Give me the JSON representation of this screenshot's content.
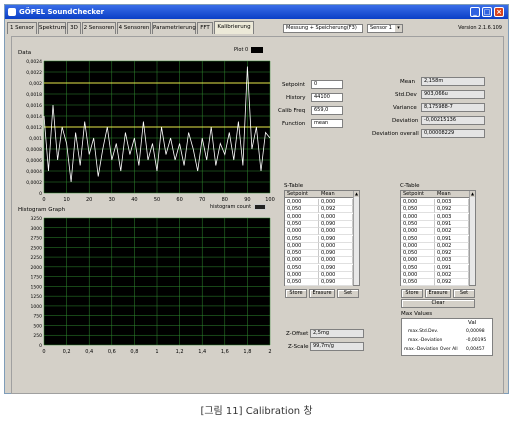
{
  "window": {
    "title": "GÖPEL SoundChecker"
  },
  "tabs": [
    "1 Sensor",
    "Spektrum",
    "3D",
    "2 Sensoren",
    "4 Sensoren",
    "Parametrierung",
    "FFT",
    "Kalibrierung"
  ],
  "toolbar": {
    "mode_select": "Messung + Speicherung(F3)",
    "sensor_select": "Sensor 1",
    "version": "Version 2.1.6.109"
  },
  "data_plot": {
    "title": "Data",
    "legend": "Plot 0",
    "y_ticks": [
      "0,0024",
      "0,0022",
      "0,002",
      "0,0018",
      "0,0016",
      "0,0014",
      "0,0012",
      "0,001",
      "0,0008",
      "0,0006",
      "0,0004",
      "0,0002",
      "0"
    ],
    "x_ticks": [
      "0",
      "10",
      "20",
      "30",
      "40",
      "50",
      "60",
      "70",
      "80",
      "90",
      "100"
    ]
  },
  "histogram": {
    "title": "Histogram Graph",
    "legend": "histogram count",
    "y_ticks": [
      "3250",
      "3000",
      "2750",
      "2500",
      "2250",
      "2000",
      "1750",
      "1500",
      "1250",
      "1000",
      "750",
      "500",
      "250",
      "0"
    ],
    "x_ticks": [
      "0",
      "0,2",
      "0,4",
      "0,6",
      "0,8",
      "1",
      "1,2",
      "1,4",
      "1,6",
      "1,8",
      "2"
    ]
  },
  "settings": [
    {
      "label": "Setpoint",
      "value": "0"
    },
    {
      "label": "History",
      "value": "44100"
    },
    {
      "label": "Calib Freq",
      "value": "659,0"
    },
    {
      "label": "Function",
      "value": "mean"
    }
  ],
  "stats": [
    {
      "label": "Mean",
      "value": "2,158m"
    },
    {
      "label": "Std.Dev",
      "value": "903,066u"
    },
    {
      "label": "Variance",
      "value": "8,175988-7"
    },
    {
      "label": "Deviation",
      "value": "-0,00215136"
    },
    {
      "label": "Deviation overall",
      "value": "0,00008229"
    }
  ],
  "s_table": {
    "title": "S-Table",
    "headers": [
      "Setpoint",
      "Mean"
    ],
    "rows": [
      [
        "0,000",
        "0,000"
      ],
      [
        "0,050",
        "0,092"
      ],
      [
        "0,000",
        "0,000"
      ],
      [
        "0,050",
        "0,090"
      ],
      [
        "0,000",
        "0,000"
      ],
      [
        "0,050",
        "0,090"
      ],
      [
        "0,000",
        "0,000"
      ],
      [
        "0,050",
        "0,090"
      ],
      [
        "0,000",
        "0,000"
      ],
      [
        "0,050",
        "0,090"
      ],
      [
        "0,000",
        "0,000"
      ],
      [
        "0,050",
        "0,090"
      ]
    ],
    "buttons": [
      "Store",
      "Erasure",
      "Set"
    ]
  },
  "c_table": {
    "title": "C-Table",
    "headers": [
      "Setpoint",
      "Mean"
    ],
    "rows": [
      [
        "0,000",
        "0,003"
      ],
      [
        "0,050",
        "0,092"
      ],
      [
        "0,000",
        "0,003"
      ],
      [
        "0,050",
        "0,091"
      ],
      [
        "0,000",
        "0,002"
      ],
      [
        "0,050",
        "0,091"
      ],
      [
        "0,000",
        "0,002"
      ],
      [
        "0,050",
        "0,092"
      ],
      [
        "0,000",
        "0,003"
      ],
      [
        "0,050",
        "0,091"
      ],
      [
        "0,000",
        "0,002"
      ],
      [
        "0,050",
        "0,092"
      ]
    ],
    "buttons": [
      "Store",
      "Erasure",
      "Set"
    ],
    "clear_label": "Clear"
  },
  "offsets": [
    {
      "label": "Z-Offset",
      "value": "2,5mg"
    },
    {
      "label": "Z-Scale",
      "value": "99,7m/g"
    }
  ],
  "max_values": {
    "title": "Max Values",
    "col_header": "Val",
    "rows": [
      {
        "label": "max.Std.Dev.",
        "value": "0,00098"
      },
      {
        "label": "max.-Deviation",
        "value": "-0,00195"
      },
      {
        "label": "max.-Deviation Over All",
        "value": "0,00457"
      }
    ]
  },
  "caption": "[그림 11] Calibration 창",
  "colors": {
    "plot_bg": "#000000",
    "grid": "#2f8a2f",
    "signal": "#ffffff",
    "limit": "#e8e84a"
  },
  "chart_data": [
    {
      "type": "line",
      "title": "Data",
      "xlim": [
        0,
        100
      ],
      "ylim": [
        0,
        0.0024
      ],
      "grid": true,
      "series": [
        {
          "name": "Plot 0",
          "x": [
            0,
            2,
            4,
            6,
            8,
            10,
            12,
            14,
            16,
            18,
            20,
            22,
            24,
            26,
            28,
            30,
            32,
            34,
            36,
            38,
            40,
            42,
            44,
            46,
            48,
            50,
            52,
            54,
            56,
            58,
            60,
            62,
            64,
            66,
            68,
            70,
            72,
            74,
            76,
            78,
            80,
            82,
            84,
            86,
            88,
            90,
            92,
            94,
            96,
            98,
            100
          ],
          "values": [
            0.0014,
            0.0004,
            0.0016,
            0.0006,
            0.0012,
            0.0009,
            0.0002,
            0.0011,
            0.0005,
            0.0013,
            0.0007,
            0.001,
            0.0003,
            0.0008,
            0.0012,
            0.0006,
            0.0009,
            0.0004,
            0.0011,
            0.0007,
            0.001,
            0.0005,
            0.0013,
            0.0006,
            0.0009,
            0.0004,
            0.0012,
            0.0007,
            0.001,
            0.0006,
            0.0009,
            0.0005,
            0.0011,
            0.0008,
            0.0004,
            0.001,
            0.0006,
            0.0012,
            0.0005,
            0.0009,
            0.0007,
            0.0011,
            0.0006,
            0.0013,
            0.0005,
            0.0023,
            0.0008,
            0.0012,
            0.0004,
            0.0011,
            0.001
          ]
        }
      ],
      "hlines": [
        0.0012,
        0.002
      ]
    },
    {
      "type": "bar",
      "title": "Histogram Graph",
      "xlim": [
        0,
        2
      ],
      "ylim": [
        0,
        3250
      ],
      "grid": true,
      "series": [
        {
          "name": "histogram count",
          "values": []
        }
      ]
    }
  ]
}
